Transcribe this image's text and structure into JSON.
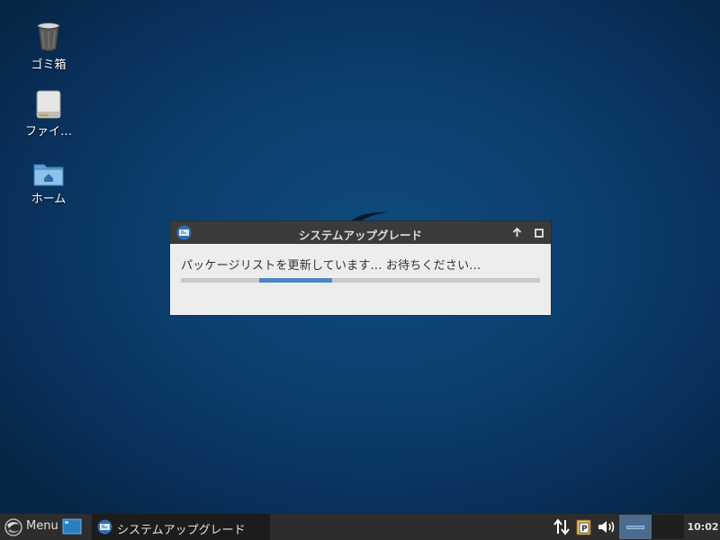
{
  "desktop": {
    "icons": [
      {
        "label": "ゴミ箱",
        "icon": "trash-icon"
      },
      {
        "label": "ファイ…",
        "icon": "drive-icon"
      },
      {
        "label": "ホーム",
        "icon": "home-folder-icon"
      }
    ]
  },
  "dialog": {
    "title": "システムアップグレード",
    "message": "パッケージリストを更新しています... お待ちください...",
    "progress": {
      "value_start": 0.217,
      "value_end": 0.422,
      "mode": "indeterminate"
    }
  },
  "taskbar": {
    "menu_label": "Menu",
    "tasks": [
      {
        "label": "システムアップグレード"
      }
    ],
    "clock": "10:02",
    "tray": [
      "network-icon",
      "parcellite-icon",
      "volume-icon"
    ],
    "workspaces": 2
  },
  "colors": {
    "accent": "#4a86c8",
    "desktop": "#0c3f6e",
    "panel": "#2d2d2d"
  }
}
